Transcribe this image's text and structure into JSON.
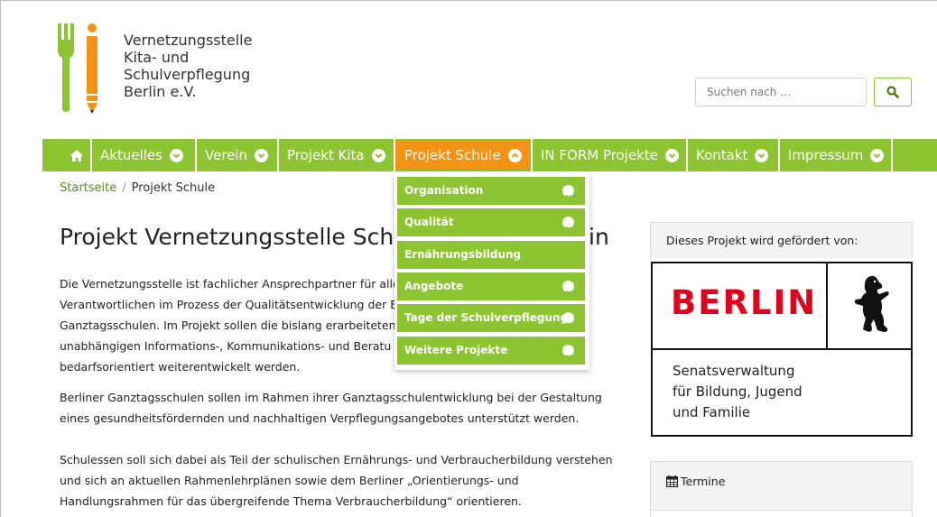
{
  "colors": {
    "accent_green": "#8cc432",
    "accent_orange": "#f39314",
    "berlin_red": "#e2001a",
    "link_green": "#5a8a1e"
  },
  "header": {
    "logo_lines": [
      "Vernetzungsstelle",
      "Kita- und",
      "Schulverpflegung",
      "Berlin e.V."
    ],
    "logo_icons": [
      "fork-icon",
      "pencil-icon"
    ]
  },
  "search": {
    "placeholder": "Suchen nach …",
    "button_icon": "search-icon"
  },
  "nav": {
    "home_icon": "home-icon",
    "items": [
      {
        "label": "Aktuelles",
        "active": false
      },
      {
        "label": "Verein",
        "active": false
      },
      {
        "label": "Projekt Kita",
        "active": false
      },
      {
        "label": "Projekt Schule",
        "active": true
      },
      {
        "label": "IN FORM Projekte",
        "active": false
      },
      {
        "label": "Kontakt",
        "active": false
      },
      {
        "label": "Impressum",
        "active": false
      }
    ]
  },
  "dropdown": {
    "items": [
      {
        "label": "Organisation",
        "has_chevron": true
      },
      {
        "label": "Qualität",
        "has_chevron": true
      },
      {
        "label": "Ernährungsbildung",
        "has_chevron": false
      },
      {
        "label": "Angebote",
        "has_chevron": true
      },
      {
        "label": "Tage der Schulverpflegung",
        "has_chevron": true
      },
      {
        "label": "Weitere Projekte",
        "has_chevron": true
      }
    ]
  },
  "breadcrumb": {
    "home": "Startseite",
    "separator": "/",
    "current": "Projekt Schule"
  },
  "main": {
    "title_left": "Projekt Vernetzungsstelle Schu",
    "title_right": "in",
    "paragraph1": [
      "Die Vernetzungsstelle ist fachlicher Ansprechpartner für alle",
      "Verantwortlichen im Prozess der Qualitätsentwicklung der E",
      "Ganztagsschulen. Im Projekt sollen die bislang erarbeiteten",
      "unabhängigen Informations-, Kommunikations- und Beratu",
      "bedarfsorientiert weiterentwickelt werden."
    ],
    "paragraph2": [
      "Berliner Ganztagsschulen sollen im Rahmen ihrer Ganztagsschulentwicklung bei der Gestaltung",
      "eines gesundheitsfördernden und nachhaltigen Verpflegungsangebotes unterstützt werden."
    ],
    "paragraph3": [
      "Schulessen soll sich dabei als Teil der schulischen Ernährungs- und Verbraucherbildung verstehen",
      "und sich an aktuellen Rahmenlehrplänen sowie dem Berliner „Orientierungs- und",
      "Handlungsrahmen für das übergreifende Thema Verbraucherbildung“ orientieren."
    ]
  },
  "sidebar": {
    "funding_heading": "Dieses Projekt wird gefördert von:",
    "berlin_logo": {
      "word": "BERLIN",
      "icon": "berlin-bear-icon",
      "senat_lines": [
        "Senatsverwaltung",
        "für Bildung, Jugend",
        "und Familie"
      ]
    },
    "termine_icon": "calendar-icon",
    "termine_heading": "Termine"
  }
}
